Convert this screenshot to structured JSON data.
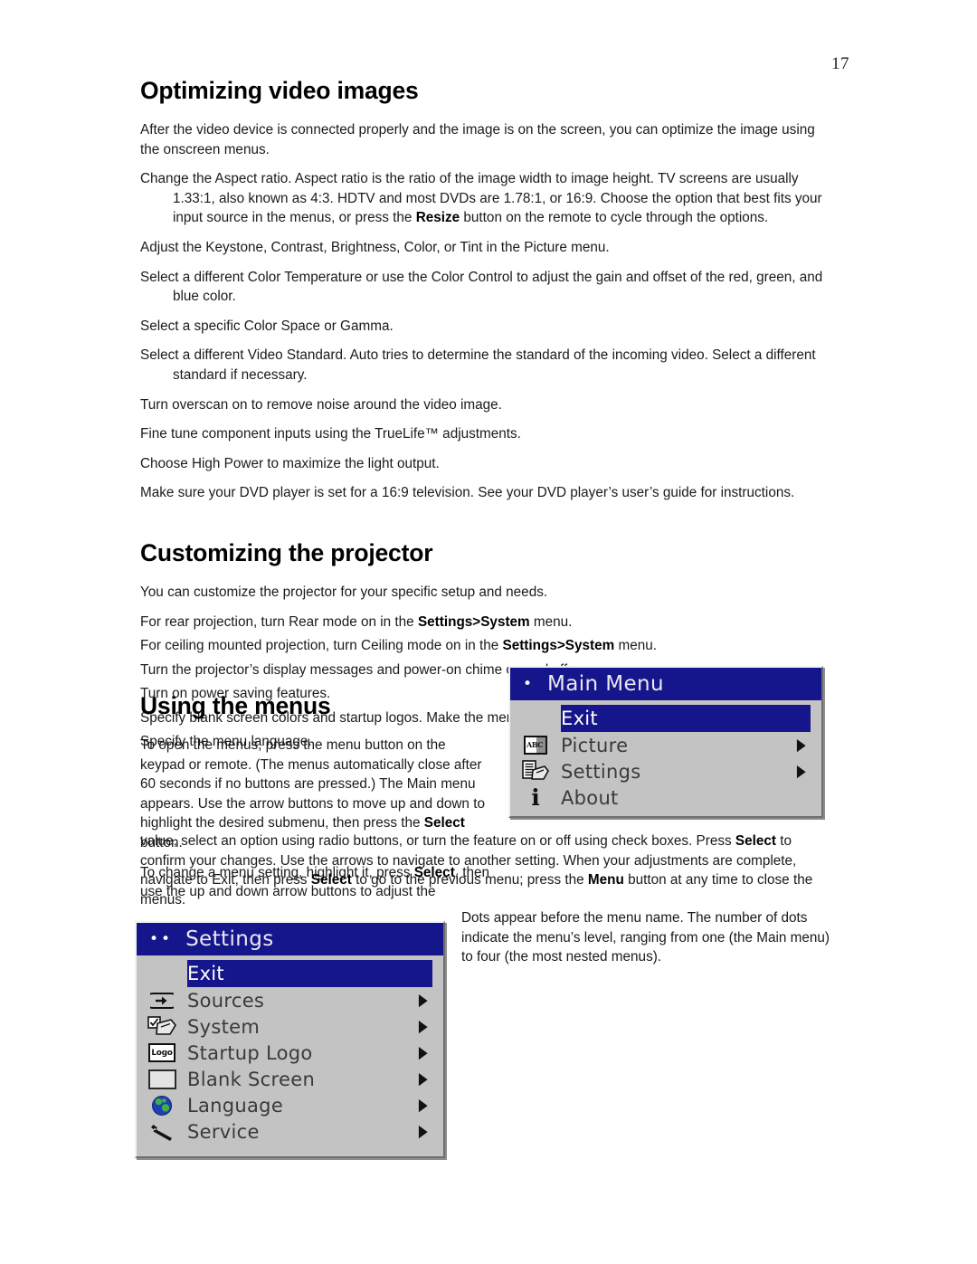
{
  "page": {
    "number": "17"
  },
  "sections": {
    "video": {
      "heading": "Optimizing video images",
      "intro": "After the video device is connected properly and the image is on the screen, you can optimize the image using the onscreen menus.",
      "items": [
        "Change the Aspect ratio. Aspect ratio is the ratio of the image width to image height. TV screens are usually 1.33:1, also known as 4:3. HDTV and most DVDs are 1.78:1, or 16:9. Choose the option that best fits your input source in the menus, or press the Resize button on the remote to cycle through the options.",
        "Adjust the Keystone, Contrast, Brightness, Color, or Tint in the Picture menu.",
        "Select a different Color Temperature or use the Color Control to adjust the gain and offset of the red, green, and blue color.",
        "Select a specific Color Space or Gamma.",
        "Select a different Video Standard. Auto tries to determine the standard of the incoming video. Select a different standard if necessary.",
        "Turn overscan on to remove noise around the video image.",
        "Fine tune component inputs using the TrueLife™ adjustments.",
        "Choose High Power to maximize the light output.",
        "Make sure your DVD player is set for a 16:9 television. See your DVD player’s user’s guide for instructions."
      ],
      "bold_terms": [
        "Resize"
      ]
    },
    "customizing": {
      "heading": "Customizing the projector",
      "intro": "You can customize the projector for your specific setup and needs.",
      "items": [
        "For rear projection, turn Rear mode on in the Settings>System menu.",
        "For ceiling mounted projection, turn Ceiling mode on in the Settings>System menu.",
        "Turn the projector’s display messages and power-on chime on and off.",
        "Turn on power saving features.",
        "Specify blank screen colors and startup logos. Make the menus translucent.",
        "Specify the menu language."
      ],
      "bold_terms": [
        "Settings>System"
      ]
    },
    "using_menus": {
      "heading": "Using the menus",
      "para1_a": "To open the menus, press the menu button on the keypad or remote. (The menus automatically close after 60 seconds if no buttons are pressed.) The Main menu appears. Use the arrow buttons to move up and down to highlight the desired submenu, then press the ",
      "para1_bold": "Select",
      "para1_b": " button.",
      "para2_a": "To change a menu setting, highlight it, press ",
      "para2_bold1": "Select",
      "para2_b": ", then use the up and down arrow buttons to adjust the ",
      "para3_a": "value, select an option using radio buttons, or turn the feature on or off using check boxes. Press ",
      "para3_bold1": "Select",
      "para3_b": " to confirm your changes. Use the arrows to navigate to another setting. When your adjustments are complete, navigate to Exit, then press ",
      "para3_bold2": "Select",
      "para3_c": " to go to the previous menu; press the ",
      "para3_bold3": "Menu",
      "para3_d": " button at any time to close the menus."
    },
    "dots_note": "Dots appear before the menu name. The number of dots indicate the menu’s level, ranging from one (the Main menu) to four (the most nested menus)."
  },
  "osd": {
    "colors": {
      "title_bar": "#15158c",
      "panel": "#c3c3c3",
      "highlight": "#15158c",
      "label_text": "#3a3a3a",
      "title_text": "#e9e9ef"
    },
    "main_menu": {
      "dots": "•",
      "title": "Main Menu",
      "rows": [
        {
          "label": "Exit",
          "icon": "none",
          "arrow": "",
          "selected": true
        },
        {
          "label": "Picture",
          "icon": "abc-icon",
          "arrow": "▶",
          "selected": false
        },
        {
          "label": "Settings",
          "icon": "settings-pages-icon",
          "arrow": "▶",
          "selected": false
        },
        {
          "label": "About",
          "icon": "info-icon",
          "arrow": "",
          "selected": false
        }
      ]
    },
    "settings_menu": {
      "dots": "••",
      "title": "Settings",
      "rows": [
        {
          "label": "Exit",
          "icon": "none",
          "arrow": "",
          "selected": true
        },
        {
          "label": "Sources",
          "icon": "input-arrow-icon",
          "arrow": "▶",
          "selected": false
        },
        {
          "label": "System",
          "icon": "checkbox-pages-icon",
          "arrow": "▶",
          "selected": false
        },
        {
          "label": "Startup Logo",
          "icon": "logo-box-icon",
          "arrow": "▶",
          "selected": false
        },
        {
          "label": "Blank Screen",
          "icon": "blank-rectangle-icon",
          "arrow": "▶",
          "selected": false
        },
        {
          "label": "Language",
          "icon": "globe-icon",
          "arrow": "▶",
          "selected": false
        },
        {
          "label": "Service",
          "icon": "wrench-icon",
          "arrow": "▶",
          "selected": false
        }
      ]
    }
  }
}
